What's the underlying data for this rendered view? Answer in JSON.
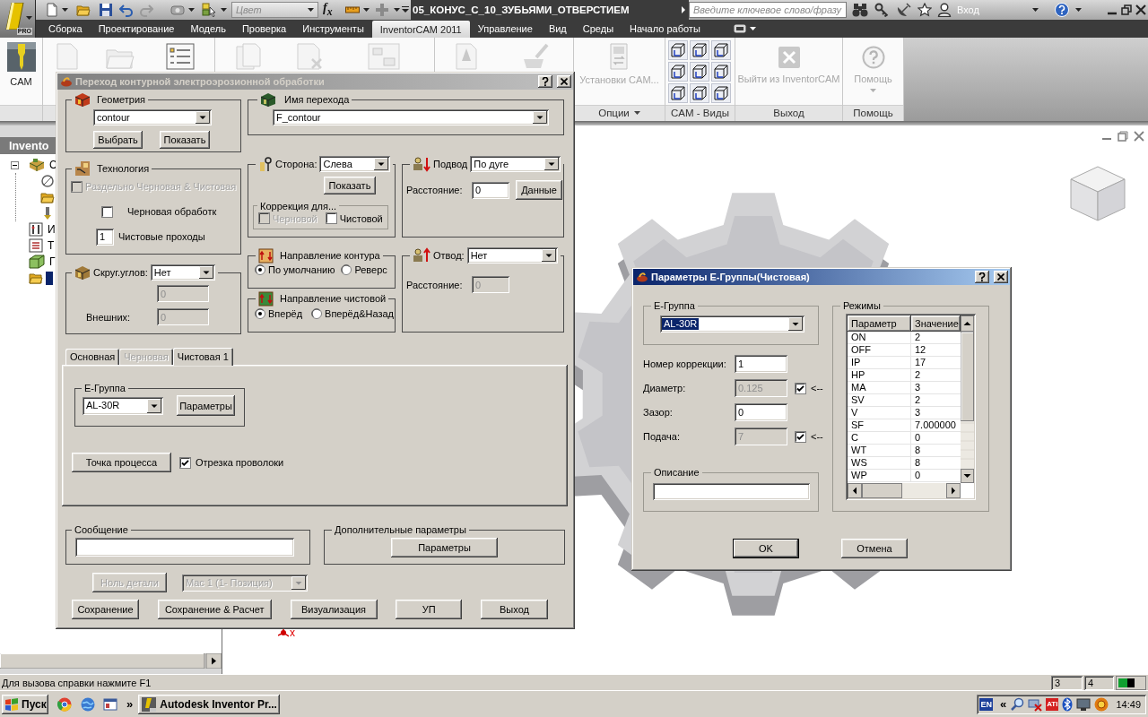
{
  "title_bar": {
    "app_badge": "PRO",
    "color_field": {
      "placeholder": "Цвет"
    },
    "function_button": "f$_{x}$",
    "document_title": "05_КОНУС_С_10_ЗУБЬЯМИ_ОТВЕРСТИЕМ",
    "search": {
      "placeholder": "Введите ключевое слово/фразу"
    },
    "sign_in": "Вход"
  },
  "ribbon_tabs": [
    {
      "label": "Сборка",
      "selected": false
    },
    {
      "label": "Проектирование",
      "selected": false
    },
    {
      "label": "Модель",
      "selected": false
    },
    {
      "label": "Проверка",
      "selected": false
    },
    {
      "label": "Инструменты",
      "selected": false
    },
    {
      "label": "InventorCAM 2011",
      "selected": true
    },
    {
      "label": "Управление",
      "selected": false
    },
    {
      "label": "Вид",
      "selected": false
    },
    {
      "label": "Среды",
      "selected": false
    },
    {
      "label": "Начало работы",
      "selected": false
    }
  ],
  "ribbon": {
    "cam_button": "CAM",
    "panels": [
      {
        "kind": "settings",
        "label": "Опции",
        "menu": true,
        "button": {
          "label": "Установки CAM...",
          "disabled": true,
          "menu": false
        }
      },
      {
        "kind": "views",
        "label": "CAM - Виды",
        "menu": false
      },
      {
        "kind": "exit",
        "label": "Выход",
        "menu": false,
        "button": {
          "label": "Выйти из InventorCAM",
          "disabled": true,
          "menu": false
        }
      },
      {
        "kind": "help",
        "label": "Помощь",
        "menu": false,
        "button": {
          "label": "Помощь",
          "disabled": true,
          "menu": true
        }
      }
    ]
  },
  "browser": {
    "title": "Invento",
    "tree": [
      {
        "kind": "assembly",
        "label": "С",
        "expanded": true,
        "selected": false,
        "children": [
          {
            "kind": "sketch"
          },
          {
            "kind": "folder"
          },
          {
            "kind": "tool"
          }
        ]
      },
      {
        "kind": "tools",
        "label": "И",
        "selected": false
      },
      {
        "kind": "list",
        "label": "Т",
        "selected": false
      },
      {
        "kind": "box",
        "label": "Г",
        "selected": false
      },
      {
        "kind": "folder",
        "selected": true
      }
    ]
  },
  "viewport": {
    "axis_label": "x"
  },
  "operation_dialog": {
    "title": "Переход контурной электроэрозионной обработки",
    "active": false,
    "geometry": {
      "label": "Геометрия",
      "value": "contour",
      "buttons": [
        "Выбрать",
        "Показать"
      ]
    },
    "operation_name": {
      "label": "Имя перехода",
      "value": "F_contour"
    },
    "technology": {
      "label": "Технология",
      "options": [
        {
          "label": "Раздельно Черновая & Чистовая",
          "checked": false,
          "disabled": true
        },
        {
          "label": "Черновая обработк",
          "checked": false,
          "disabled": false
        }
      ],
      "passes": {
        "label": "Чистовые проходы",
        "value": "1"
      }
    },
    "side": {
      "label": "Сторона:",
      "value": "Слева",
      "button": "Показать",
      "compensation": {
        "label": "Коррекция для...",
        "options": [
          {
            "label": "Черновой",
            "checked": false,
            "disabled": true
          },
          {
            "label": "Чистовой",
            "checked": false,
            "disabled": false
          }
        ]
      }
    },
    "lead_in": {
      "label": "Подвод",
      "value": "По дуге",
      "distance": {
        "label": "Расстояние:",
        "value": "0",
        "disabled": false
      },
      "button": "Данные"
    },
    "corner_rounding": {
      "label": "Скруг.углов:",
      "value": "Нет",
      "fields": [
        {
          "value": "0",
          "disabled": true
        },
        {
          "label": "Внешних:",
          "value": "0",
          "disabled": true
        }
      ]
    },
    "contour_direction": {
      "label": "Направление контура",
      "options": [
        {
          "label": "По умолчанию",
          "selected": true
        },
        {
          "label": "Реверс",
          "selected": false
        }
      ]
    },
    "finish_direction": {
      "label": "Направление чистовой",
      "options": [
        {
          "label": "Вперёд",
          "selected": true
        },
        {
          "label": "Вперёд&Назад",
          "selected": false
        }
      ]
    },
    "lead_out": {
      "label": "Отвод:",
      "value": "Нет",
      "distance": {
        "label": "Расстояние:",
        "value": "0",
        "disabled": true
      }
    },
    "tabs": [
      {
        "label": "Основная",
        "selected": false,
        "disabled": false
      },
      {
        "label": "Черновая",
        "selected": false,
        "disabled": true
      },
      {
        "label": "Чистовая 1",
        "selected": true,
        "disabled": false
      }
    ],
    "finish_tab": {
      "egroup": {
        "label": "E-Группа",
        "value": "AL-30R",
        "button": "Параметры"
      },
      "process_point": "Точка процесса",
      "wire_cut": {
        "label": "Отрезка проволоки",
        "checked": true
      }
    },
    "message": {
      "label": "Сообщение"
    },
    "extra_parameters": {
      "label": "Дополнительные параметры",
      "button": "Параметры"
    },
    "part_zero": {
      "label": "Ноль детали",
      "disabled": true
    },
    "machine": {
      "value": "Mac 1 (1- Позиция)",
      "disabled": true
    },
    "buttons": [
      "Сохранение",
      "Сохранение & Расчет",
      "Визуализация",
      "УП",
      "Выход"
    ]
  },
  "egroup_dialog": {
    "title": "Параметры E-Группы(Чистовая)",
    "active": true,
    "egroup": {
      "label": "E-Группа",
      "value": "AL-30R",
      "highlighted": true
    },
    "fields": [
      {
        "label": "Номер коррекции:",
        "value": "1",
        "disabled": false
      },
      {
        "label": "Диаметр:",
        "value": "0.125",
        "disabled": true,
        "checked": true,
        "arrow": "<--"
      },
      {
        "label": "Зазор:",
        "value": "0",
        "disabled": false
      },
      {
        "label": "Подача:",
        "value": "7",
        "disabled": true,
        "checked": true,
        "arrow": "<--"
      }
    ],
    "description": {
      "label": "Описание"
    },
    "modes": {
      "label": "Режимы",
      "columns": [
        "Параметр",
        "Значение"
      ],
      "rows": [
        [
          "ON",
          "2"
        ],
        [
          "OFF",
          "12"
        ],
        [
          "IP",
          "17"
        ],
        [
          "HP",
          "2"
        ],
        [
          "MA",
          "3"
        ],
        [
          "SV",
          "2"
        ],
        [
          "V",
          "3"
        ],
        [
          "SF",
          "7.000000"
        ],
        [
          "C",
          "0"
        ],
        [
          "WT",
          "8"
        ],
        [
          "WS",
          "8"
        ],
        [
          "WP",
          "0"
        ]
      ]
    },
    "buttons": [
      {
        "label": "OK",
        "default": true
      },
      {
        "label": "Отмена",
        "default": false
      }
    ]
  },
  "status_bar": {
    "text": "Для вызова справки нажмите F1",
    "cells": [
      "3",
      "4"
    ]
  },
  "taskbar": {
    "start": "Пуск",
    "more": "»",
    "windows": [
      {
        "label": "Autodesk Inventor Pr...",
        "selected": false
      }
    ],
    "tray": {
      "language": "EN",
      "expand": "«",
      "badge": "ATI",
      "clock": "14:49"
    }
  }
}
